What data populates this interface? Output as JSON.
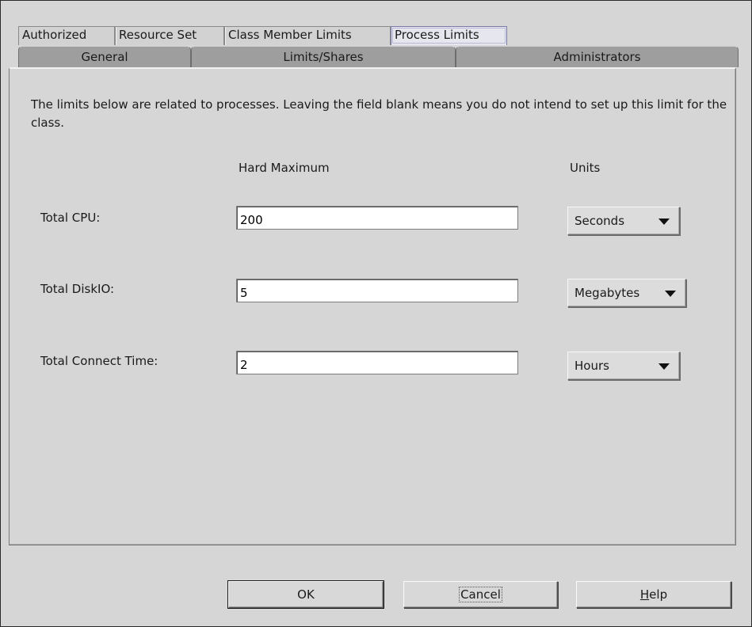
{
  "tabs": {
    "row1": [
      {
        "label": "Authorized",
        "active": false
      },
      {
        "label": "Resource Set",
        "active": false
      },
      {
        "label": "Class Member Limits",
        "active": false
      },
      {
        "label": "Process Limits",
        "active": true
      }
    ],
    "row2": [
      {
        "label": "General"
      },
      {
        "label": "Limits/Shares"
      },
      {
        "label": "Administrators"
      }
    ]
  },
  "panel": {
    "description": "The limits below are related to processes. Leaving the field blank means you do not intend to set up this limit for the class.",
    "col_hard_max": "Hard Maximum",
    "col_units": "Units",
    "rows": [
      {
        "label": "Total CPU:",
        "value": "200",
        "unit": "Seconds"
      },
      {
        "label": "Total DiskIO:",
        "value": "5",
        "unit": "Megabytes"
      },
      {
        "label": "Total Connect Time:",
        "value": "2",
        "unit": "Hours"
      }
    ]
  },
  "buttons": {
    "ok": "OK",
    "cancel": "Cancel",
    "help_mnemonic": "H",
    "help_rest": "elp"
  }
}
